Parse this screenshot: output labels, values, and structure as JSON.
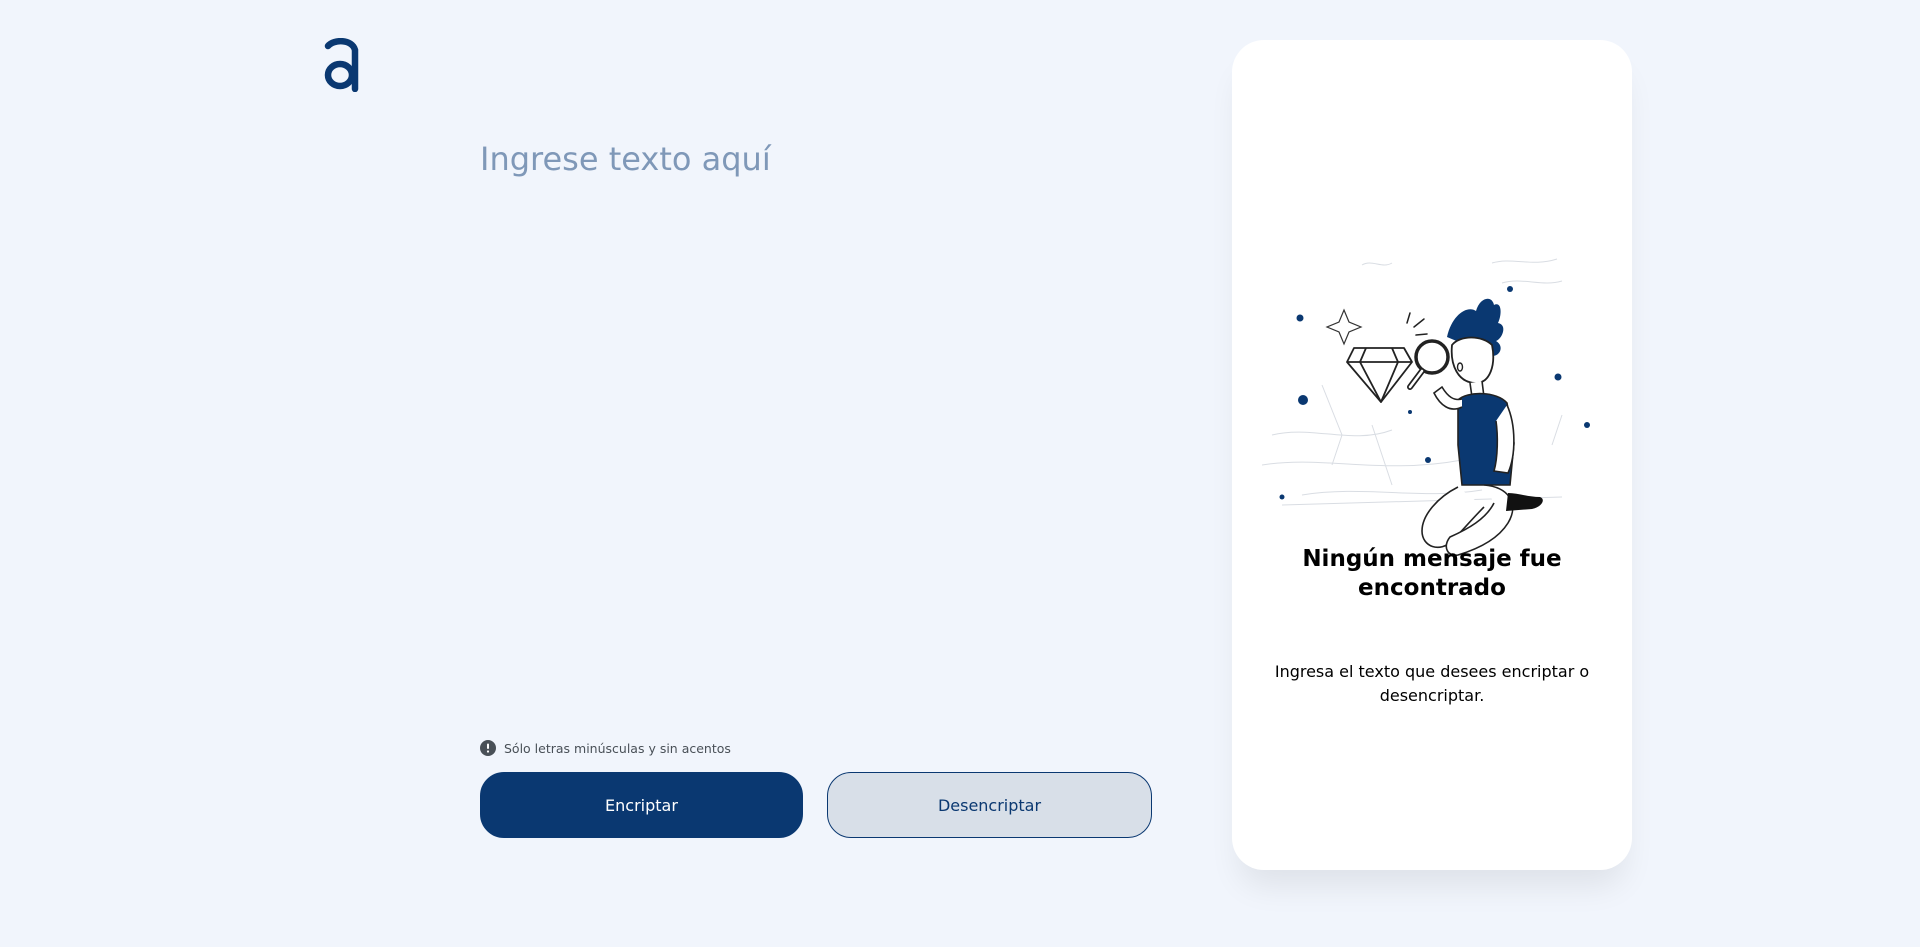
{
  "header": {
    "logo_icon": "letter-a-logo"
  },
  "input": {
    "placeholder": "Ingrese texto aquí",
    "value": ""
  },
  "hint": {
    "icon": "exclamation-circle-icon",
    "text": "Sólo letras minúsculas y sin acentos"
  },
  "buttons": {
    "encrypt_label": "Encriptar",
    "decrypt_label": "Desencriptar"
  },
  "output": {
    "illustration_icon": "person-with-magnifying-glass-and-diamond",
    "title": "Ningún mensaje fue encontrado",
    "description": "Ingresa el texto que desees encriptar o desencriptar."
  },
  "colors": {
    "background": "#f1f5fc",
    "primary": "#0a3871",
    "secondary_button": "#d8dfe8",
    "placeholder": "#7f98b8",
    "card": "#ffffff"
  }
}
